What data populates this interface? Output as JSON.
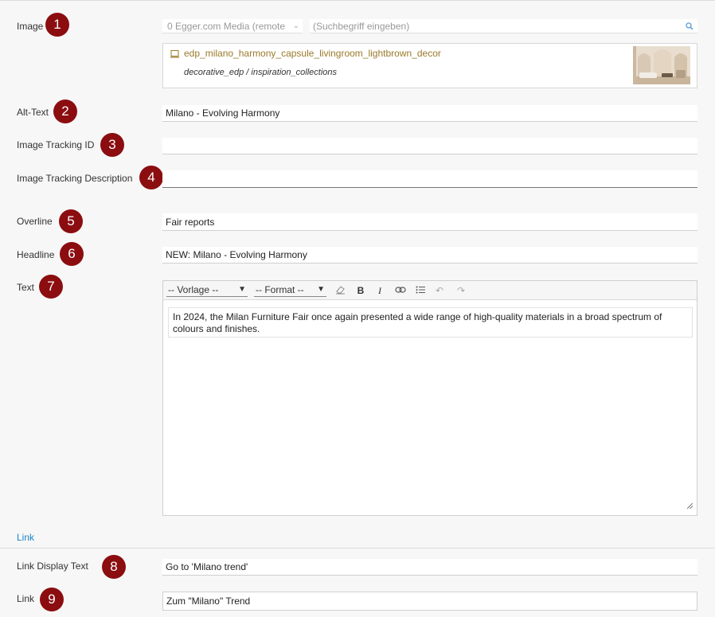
{
  "fields": {
    "image": {
      "label": "Image",
      "marker": "1",
      "source_select": "0 Egger.com Media (remote",
      "search_placeholder": "(Suchbegriff eingeben)",
      "asset_name": "edp_milano_harmony_capsule_livingroom_lightbrown_decor",
      "asset_path": "decorative_edp / inspiration_collections"
    },
    "alt_text": {
      "label": "Alt-Text",
      "marker": "2",
      "value": "Milano - Evolving Harmony"
    },
    "tracking_id": {
      "label": "Image Tracking ID",
      "marker": "3",
      "value": ""
    },
    "tracking_desc": {
      "label": "Image Tracking Description",
      "marker": "4",
      "value": ""
    },
    "overline": {
      "label": "Overline",
      "marker": "5",
      "value": "Fair reports"
    },
    "headline": {
      "label": "Headline",
      "marker": "6",
      "value": "NEW: Milano - Evolving Harmony"
    },
    "text": {
      "label": "Text",
      "marker": "7",
      "toolbar": {
        "template_select": "-- Vorlage --",
        "format_select": "-- Format --"
      },
      "content": "In 2024, the Milan Furniture Fair once again presented a wide range of high-quality materials in a broad spectrum of colours and finishes."
    }
  },
  "link_section": {
    "heading": "Link",
    "display_text": {
      "label": "Link Display Text",
      "marker": "8",
      "value": "Go to 'Milano trend'"
    },
    "link": {
      "label": "Link",
      "marker": "9",
      "value": "Zum \"Milano\" Trend"
    }
  },
  "colors": {
    "marker": "#8b0d10",
    "link_heading": "#1a86c8",
    "asset_name": "#9a7a2a"
  },
  "icons": [
    "search-icon",
    "file-icon",
    "eraser-icon",
    "bold-icon",
    "italic-icon",
    "link-icon",
    "list-icon",
    "undo-icon",
    "redo-icon",
    "resize-handle-icon"
  ]
}
